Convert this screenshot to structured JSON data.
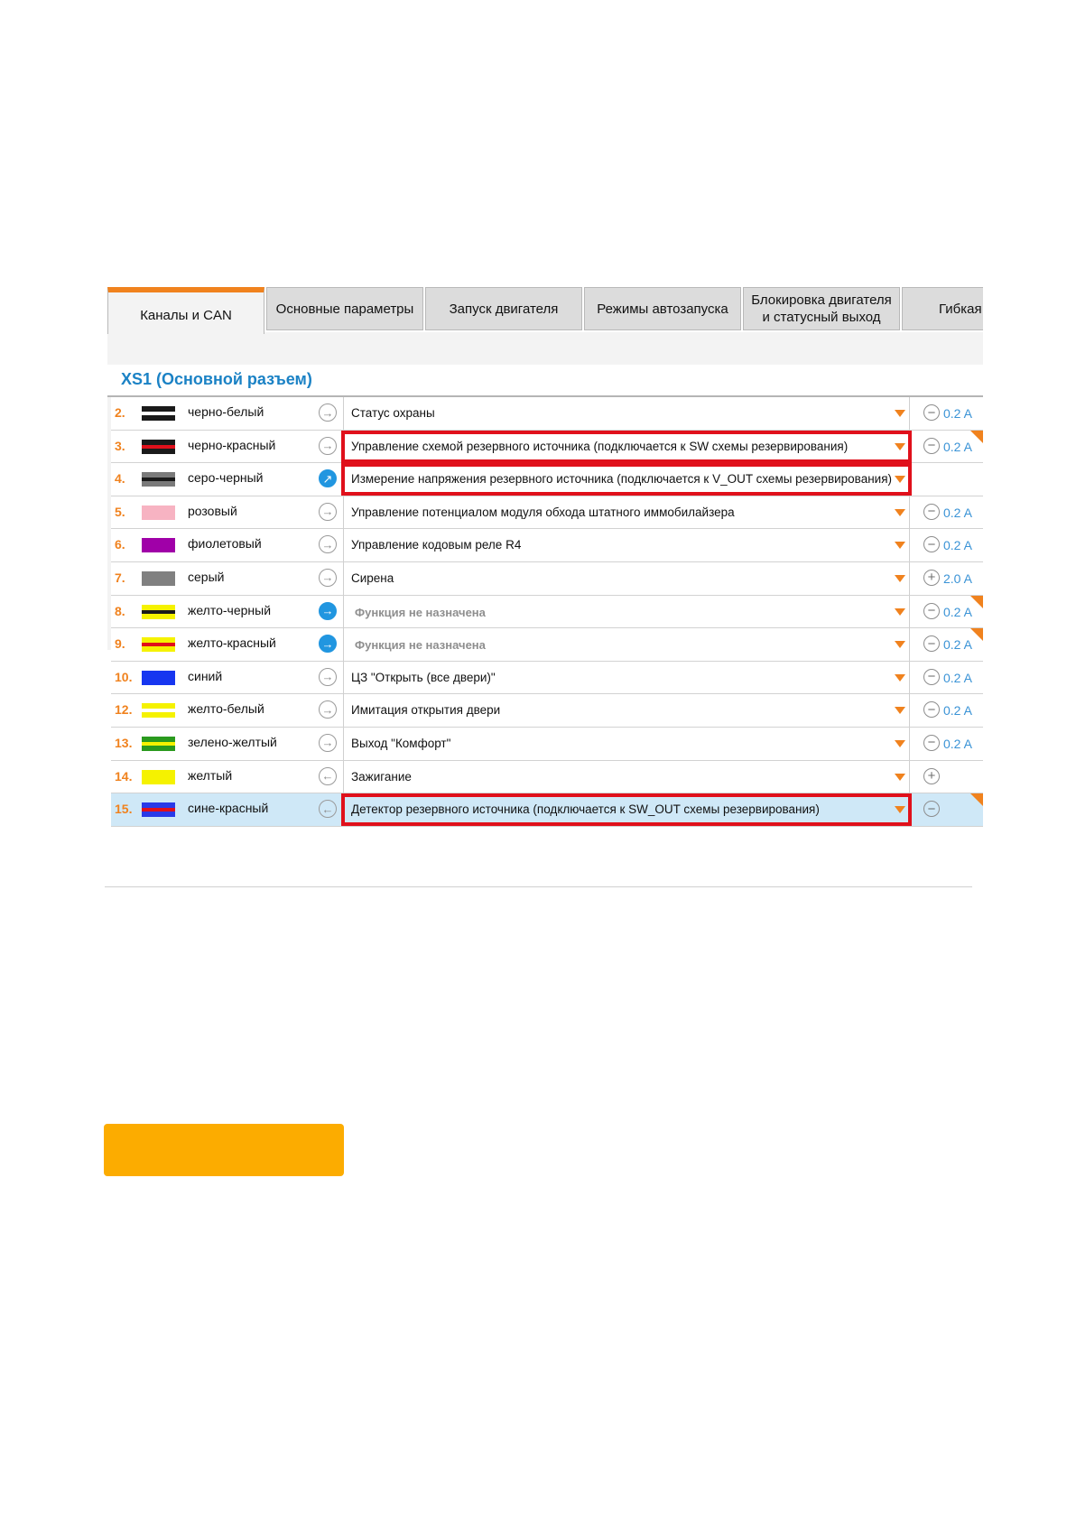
{
  "tabs": [
    {
      "label": "Каналы и CAN",
      "active": true
    },
    {
      "label": "Основные параметры",
      "active": false
    },
    {
      "label": "Запуск двигателя",
      "active": false
    },
    {
      "label": "Режимы автозапуска",
      "active": false
    },
    {
      "label": "Блокировка двигателя и статусный выход",
      "active": false
    },
    {
      "label": "Гибкая",
      "active": false
    }
  ],
  "section": {
    "title": "XS1 (Основной разъем)"
  },
  "colors": {
    "accent": "#f0821e",
    "title_blue": "#1b82c5",
    "highlight_red": "#e0101b",
    "selected_row": "#cfe8f7",
    "amp_blue": "#3a93d6",
    "bottom_block": "#fcac00"
  },
  "channels": [
    {
      "num": "2.",
      "wire": "черно-белый",
      "colors": [
        "#1a1a1a",
        "#ffffff"
      ],
      "direction": "output",
      "dir_active": false,
      "function": "Статус охраны",
      "unassigned": false,
      "highlighted": false,
      "pm": "minus",
      "amp": "0.2 A",
      "corner": false,
      "selected": false
    },
    {
      "num": "3.",
      "wire": "черно-красный",
      "colors": [
        "#1a1a1a",
        "#e0101b"
      ],
      "direction": "output",
      "dir_active": false,
      "function": "Управление схемой резервного источника (подключается к SW схемы резервирования)",
      "unassigned": false,
      "highlighted": true,
      "pm": "minus",
      "amp": "0.2 A",
      "corner": true,
      "selected": false
    },
    {
      "num": "4.",
      "wire": "серо-черный",
      "colors": [
        "#7a7a7a",
        "#1a1a1a"
      ],
      "direction": "analog",
      "dir_active": true,
      "function": "Измерение напряжения резервного источника (подключается к V_OUT схемы резервирования)",
      "unassigned": false,
      "highlighted": true,
      "pm": "",
      "amp": "",
      "corner": false,
      "selected": false
    },
    {
      "num": "5.",
      "wire": "розовый",
      "colors": [
        "#f7b3c2",
        "#f7b3c2"
      ],
      "direction": "output",
      "dir_active": false,
      "function": "Управление потенциалом модуля обхода штатного иммобилайзера",
      "unassigned": false,
      "highlighted": false,
      "pm": "minus",
      "amp": "0.2 A",
      "corner": false,
      "selected": false
    },
    {
      "num": "6.",
      "wire": "фиолетовый",
      "colors": [
        "#a000a8",
        "#a000a8"
      ],
      "direction": "output",
      "dir_active": false,
      "function": "Управление кодовым реле R4",
      "unassigned": false,
      "highlighted": false,
      "pm": "minus",
      "amp": "0.2 A",
      "corner": false,
      "selected": false
    },
    {
      "num": "7.",
      "wire": "серый",
      "colors": [
        "#808080",
        "#808080"
      ],
      "direction": "output",
      "dir_active": false,
      "function": "Сирена",
      "unassigned": false,
      "highlighted": false,
      "pm": "plus",
      "amp": "2.0 A",
      "corner": false,
      "selected": false
    },
    {
      "num": "8.",
      "wire": "желто-черный",
      "colors": [
        "#f5f200",
        "#1a1a1a"
      ],
      "direction": "output",
      "dir_active": true,
      "function": "Функция не назначена",
      "unassigned": true,
      "highlighted": false,
      "pm": "minus",
      "amp": "0.2 A",
      "corner": true,
      "selected": false
    },
    {
      "num": "9.",
      "wire": "желто-красный",
      "colors": [
        "#f5f200",
        "#e0101b"
      ],
      "direction": "output",
      "dir_active": true,
      "function": "Функция не назначена",
      "unassigned": true,
      "highlighted": false,
      "pm": "minus",
      "amp": "0.2 A",
      "corner": true,
      "selected": false
    },
    {
      "num": "10.",
      "wire": "синий",
      "colors": [
        "#1736f0",
        "#1736f0"
      ],
      "direction": "output",
      "dir_active": false,
      "function": "ЦЗ \"Открыть (все двери)\"",
      "unassigned": false,
      "highlighted": false,
      "pm": "minus",
      "amp": "0.2 A",
      "corner": false,
      "selected": false
    },
    {
      "num": "12.",
      "wire": "желто-белый",
      "colors": [
        "#f5f200",
        "#ffffff"
      ],
      "direction": "output",
      "dir_active": false,
      "function": "Имитация открытия двери",
      "unassigned": false,
      "highlighted": false,
      "pm": "minus",
      "amp": "0.2 A",
      "corner": false,
      "selected": false
    },
    {
      "num": "13.",
      "wire": "зелено-желтый",
      "colors": [
        "#2a9a1e",
        "#f5f200"
      ],
      "direction": "output",
      "dir_active": false,
      "function": "Выход \"Комфорт\"",
      "unassigned": false,
      "highlighted": false,
      "pm": "minus",
      "amp": "0.2 A",
      "corner": false,
      "selected": false
    },
    {
      "num": "14.",
      "wire": "желтый",
      "colors": [
        "#f5f200",
        "#f5f200"
      ],
      "direction": "input",
      "dir_active": false,
      "function": "Зажигание",
      "unassigned": false,
      "highlighted": false,
      "pm": "plus",
      "amp": "",
      "corner": false,
      "selected": false
    },
    {
      "num": "15.",
      "wire": "сине-красный",
      "colors": [
        "#2a3ae8",
        "#e0101b"
      ],
      "direction": "input",
      "dir_active": false,
      "function": "Детектор резервного источника (подключается к SW_OUT схемы резервирования)",
      "unassigned": false,
      "highlighted": true,
      "pm": "minus",
      "amp": "",
      "corner": true,
      "selected": true
    }
  ]
}
